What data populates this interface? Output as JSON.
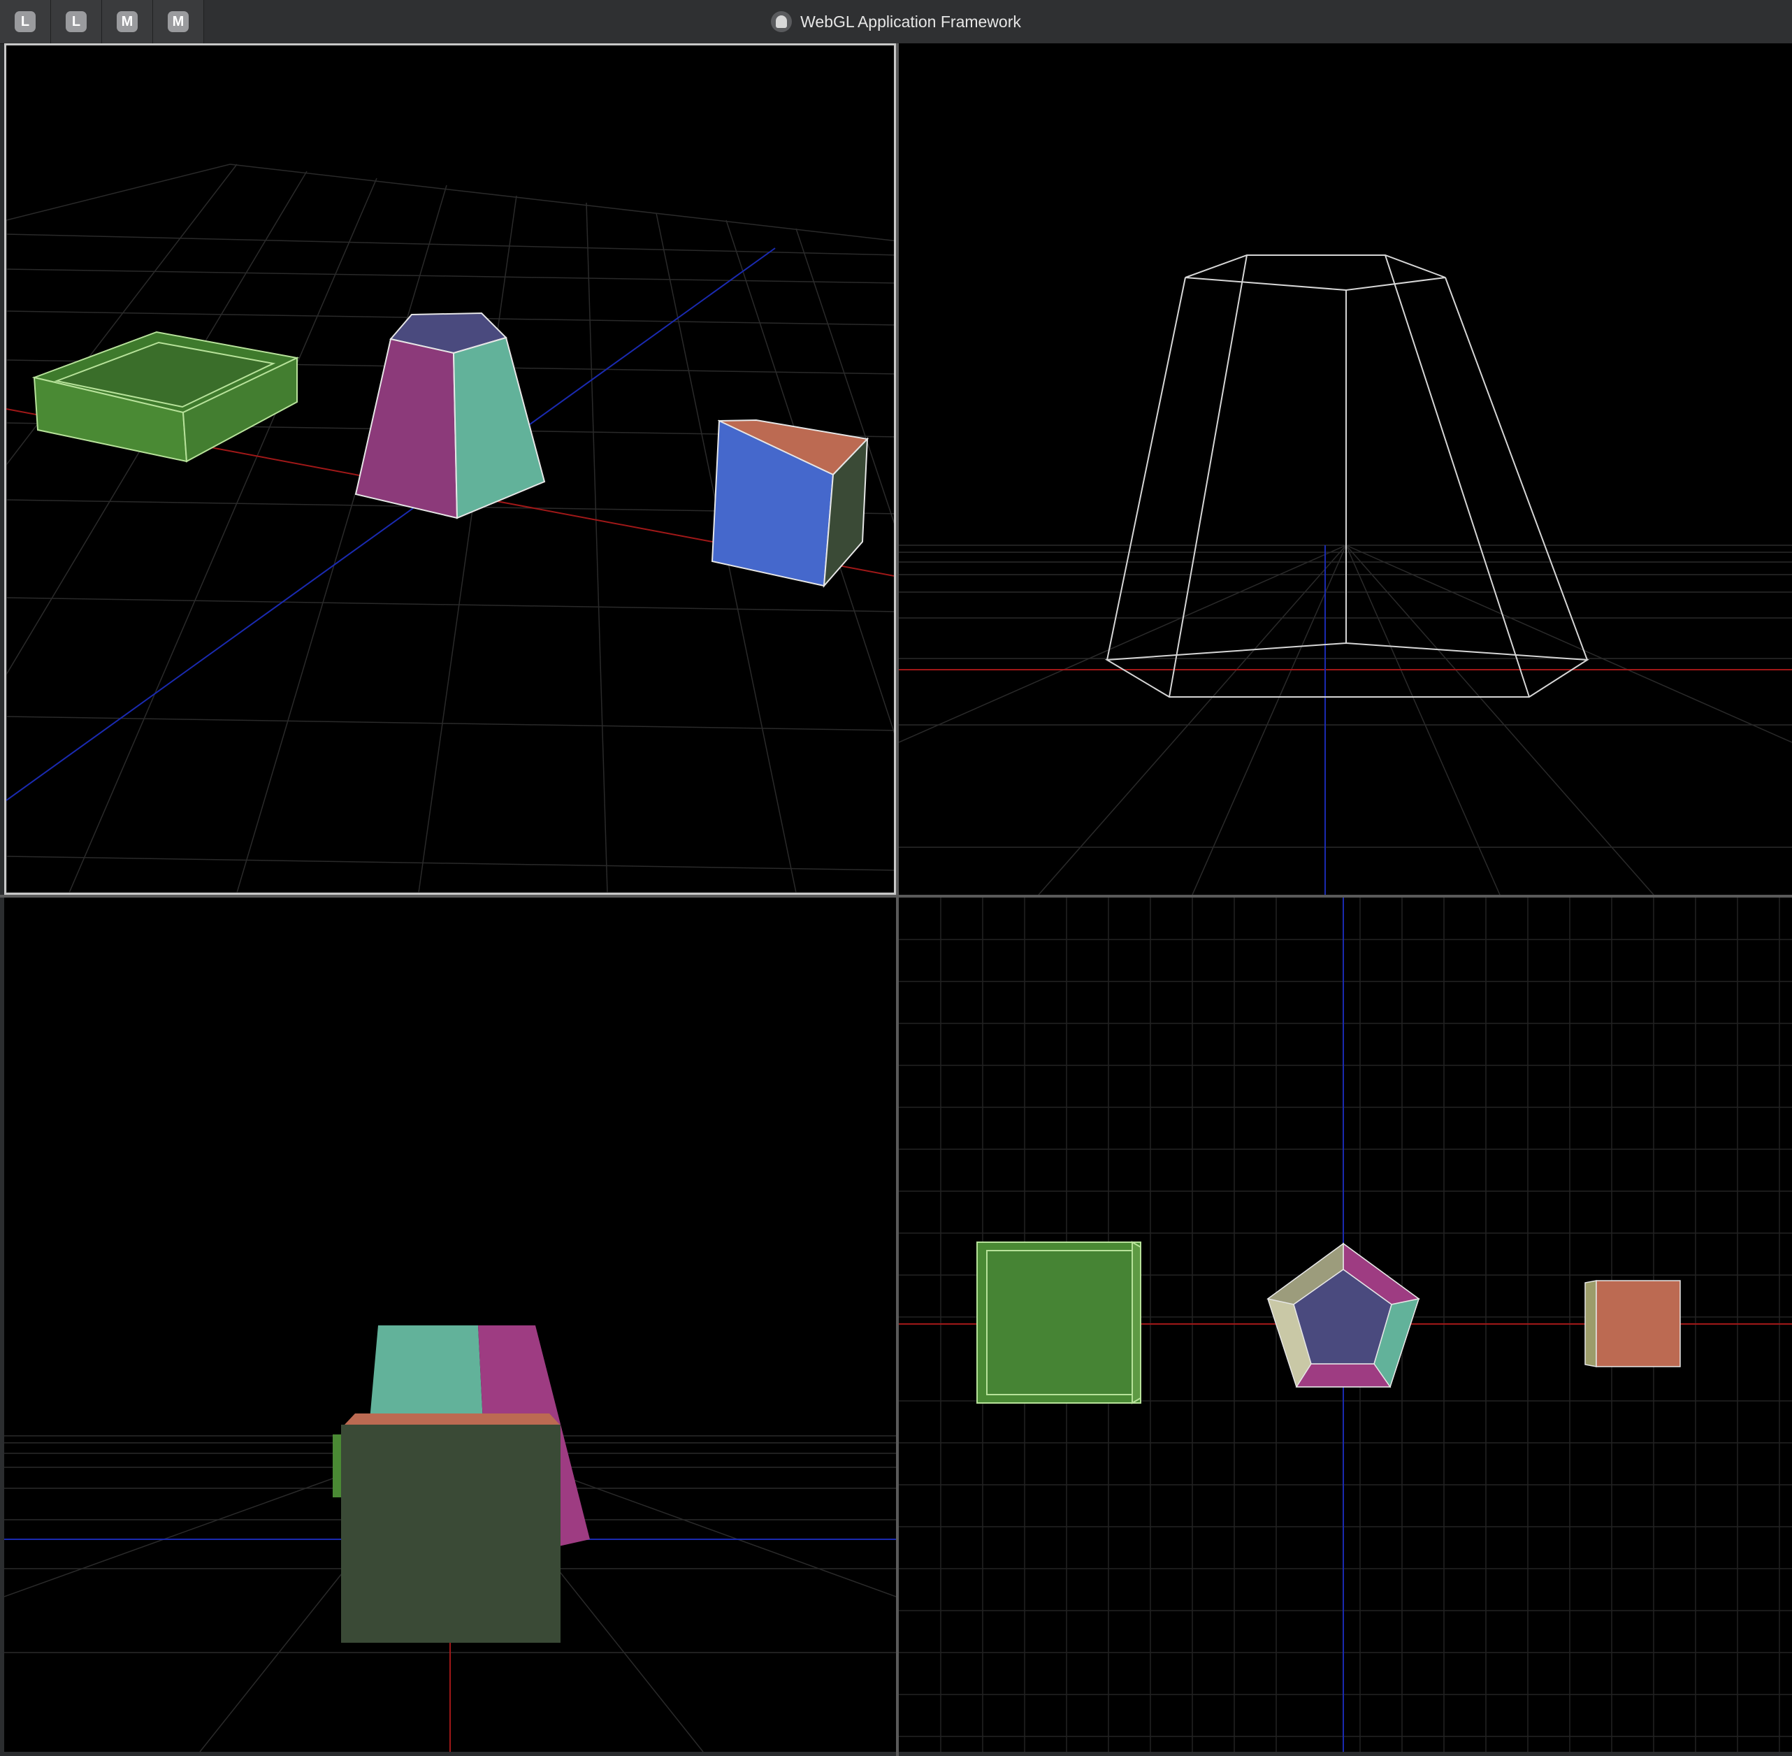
{
  "window": {
    "title": "WebGL Application Framework",
    "logo_icon": "app-logo-icon"
  },
  "tabs": [
    {
      "label": "L"
    },
    {
      "label": "L"
    },
    {
      "label": "M"
    },
    {
      "label": "M"
    }
  ],
  "colors": {
    "viewport_bg": "#000000",
    "grid": "#2a2a2a",
    "axis_x": "#a01818",
    "axis_z": "#1a2ab0",
    "green_box": "#4a8a34",
    "pyramid_magenta": "#8c3a7a",
    "pyramid_teal": "#62b29a",
    "pyramid_top": "#4a4a7e",
    "cube_blue": "#4568cc",
    "cube_orange": "#bc6a52",
    "cube_dark": "#3a4a36"
  },
  "viewports": [
    {
      "name": "perspective"
    },
    {
      "name": "wireframe"
    },
    {
      "name": "front"
    },
    {
      "name": "top"
    }
  ]
}
